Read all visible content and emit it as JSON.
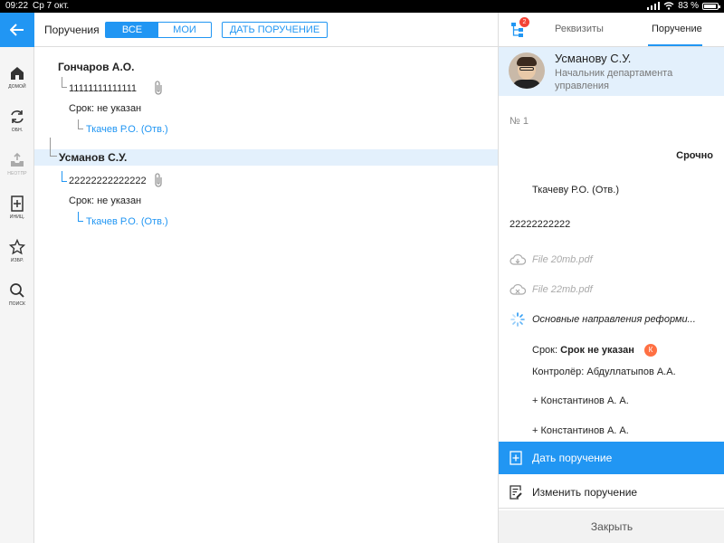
{
  "status": {
    "time": "09:22",
    "date": "Ср 7 окт.",
    "battery": "83 %"
  },
  "sidebar": {
    "items": [
      {
        "label": "ДОМОЙ",
        "icon": "home-icon"
      },
      {
        "label": "ОБН.",
        "icon": "refresh-icon"
      },
      {
        "label": "НЕОТПР",
        "icon": "outbox-icon"
      },
      {
        "label": "ИНИЦ.",
        "icon": "add-document-icon"
      },
      {
        "label": "ИЗБР.",
        "icon": "star-icon"
      },
      {
        "label": "ПОИСК",
        "icon": "search-icon"
      }
    ]
  },
  "toolbar": {
    "title": "Поручения",
    "filter_all": "ВСЕ",
    "filter_mine": "МОИ",
    "give_label": "ДАТЬ ПОРУЧЕНИЕ"
  },
  "tree": {
    "nodes": [
      {
        "author": "Гончаров А.О.",
        "text": "11111111111111",
        "deadline": "Срок: не указан",
        "executor": "Ткачев Р.О. (Отв.)"
      },
      {
        "author": "Усманов С.У.",
        "text": "22222222222222",
        "deadline": "Срок: не указан",
        "executor": "Ткачев Р.О. (Отв.)"
      }
    ]
  },
  "panel": {
    "badge_count": "2",
    "tab_details": "Реквизиты",
    "tab_order": "Поручение",
    "recipient_name": "Усманову С.У.",
    "recipient_role": "Начальник департамента управления",
    "number": "№ 1",
    "urgency": "Срочно",
    "executor": "Ткачеву Р.О. (Отв.)",
    "text": "22222222222",
    "files": [
      "File 20mb.pdf",
      "File 22mb.pdf",
      "Основные направления реформи..."
    ],
    "deadline_label": "Срок:",
    "deadline_value": "Срок не указан",
    "deadline_badge": "К",
    "controller": "Контролёр: Абдуллатыпов А.А.",
    "co_executors": [
      "+ Константинов А. А.",
      "+ Константинов А. А."
    ],
    "btn_give": "Дать поручение",
    "btn_edit": "Изменить поручение",
    "btn_close": "Закрыть"
  },
  "colors": {
    "accent": "#2196f3",
    "highlight": "#e3f0fc",
    "badge": "#f44336",
    "control_badge": "#ff7043"
  }
}
